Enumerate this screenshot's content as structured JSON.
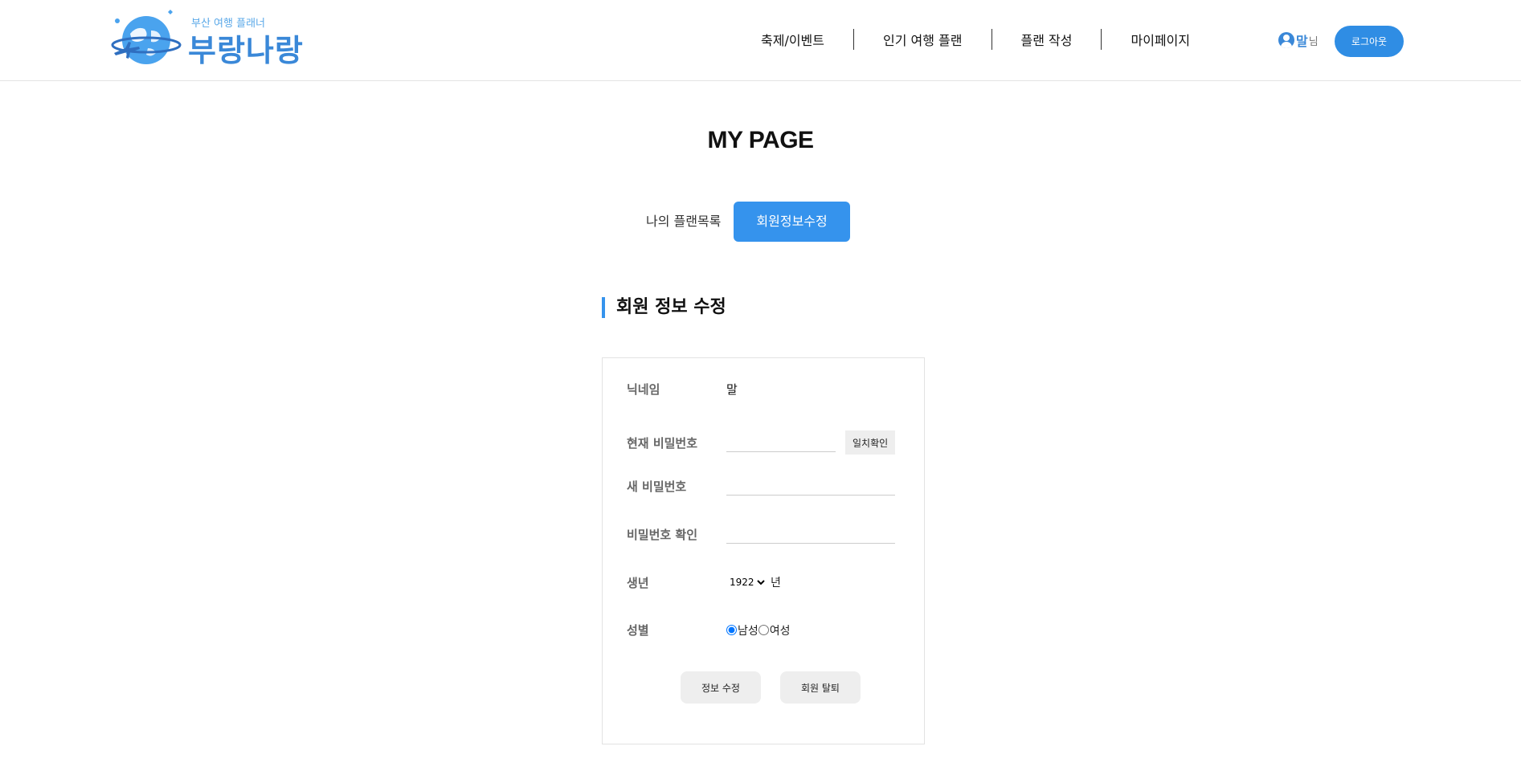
{
  "header": {
    "logo_subtitle": "부산 여행 플래너",
    "logo_title": "부랑나랑",
    "nav": [
      "축제/이벤트",
      "인기 여행 플랜",
      "플랜 작성",
      "마이페이지"
    ],
    "user_name": "말",
    "user_suffix": "님",
    "logout_label": "로그아웃"
  },
  "page_title": "MY PAGE",
  "tabs": [
    {
      "label": "나의 플랜목록",
      "active": false
    },
    {
      "label": "회원정보수정",
      "active": true
    }
  ],
  "section_title": "회원 정보 수정",
  "form": {
    "nickname_label": "닉네임",
    "nickname_value": "말",
    "current_pw_label": "현재 비밀번호",
    "check_button": "일치확인",
    "new_pw_label": "새 비밀번호",
    "confirm_pw_label": "비밀번호 확인",
    "birth_label": "생년",
    "birth_year": "1922",
    "birth_unit": "년",
    "gender_label": "성별",
    "gender_male": "남성",
    "gender_female": "여성",
    "gender_selected": "남성",
    "submit_button": "정보 수정",
    "withdraw_button": "회원 탈퇴"
  },
  "colors": {
    "accent": "#3593ed",
    "logo": "#3a88d8"
  }
}
